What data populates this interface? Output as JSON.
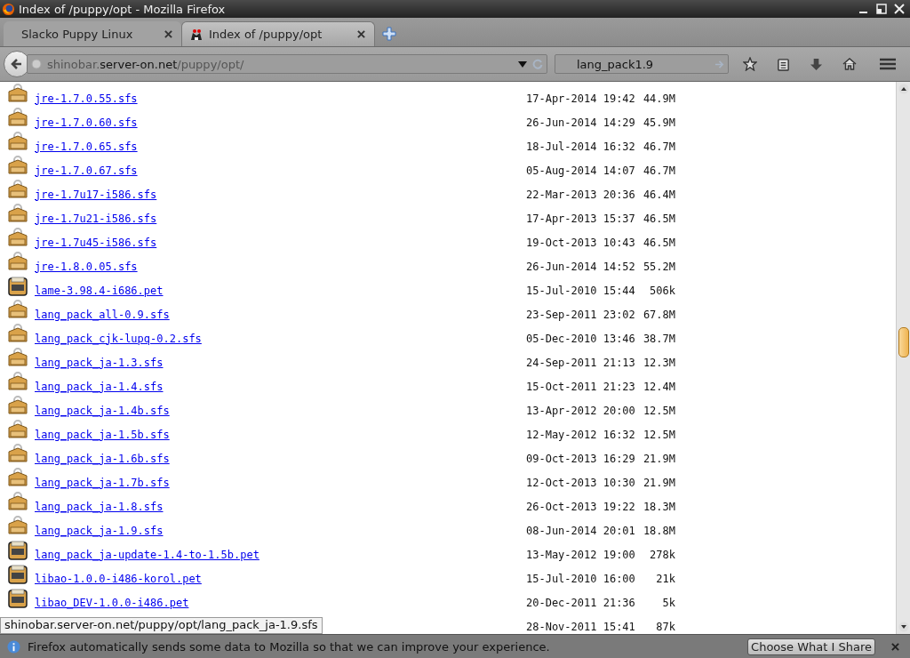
{
  "window": {
    "title": "Index of /puppy/opt - Mozilla Firefox"
  },
  "tabs": [
    {
      "label": "Slacko Puppy Linux",
      "selected": false
    },
    {
      "label": "Index of /puppy/opt",
      "selected": true
    }
  ],
  "address_bar": {
    "host_prefix": "shinobar.",
    "host": "server-on.net",
    "path": "/puppy/opt/"
  },
  "search": {
    "value": "lang_pack1.9"
  },
  "listing": [
    {
      "kind": "sfs",
      "name": "jre-1.7.0.55.sfs",
      "date": "17-Apr-2014 19:42",
      "size": "44.9M"
    },
    {
      "kind": "sfs",
      "name": "jre-1.7.0.60.sfs",
      "date": "26-Jun-2014 14:29",
      "size": "45.9M"
    },
    {
      "kind": "sfs",
      "name": "jre-1.7.0.65.sfs",
      "date": "18-Jul-2014 16:32",
      "size": "46.7M"
    },
    {
      "kind": "sfs",
      "name": "jre-1.7.0.67.sfs",
      "date": "05-Aug-2014 14:07",
      "size": "46.7M"
    },
    {
      "kind": "sfs",
      "name": "jre-1.7u17-i586.sfs",
      "date": "22-Mar-2013 20:36",
      "size": "46.4M"
    },
    {
      "kind": "sfs",
      "name": "jre-1.7u21-i586.sfs",
      "date": "17-Apr-2013 15:37",
      "size": "46.5M"
    },
    {
      "kind": "sfs",
      "name": "jre-1.7u45-i586.sfs",
      "date": "19-Oct-2013 10:43",
      "size": "46.5M"
    },
    {
      "kind": "sfs",
      "name": "jre-1.8.0.05.sfs",
      "date": "26-Jun-2014 14:52",
      "size": "55.2M"
    },
    {
      "kind": "pet",
      "name": "lame-3.98.4-i686.pet",
      "date": "15-Jul-2010 15:44",
      "size": "506k"
    },
    {
      "kind": "sfs",
      "name": "lang_pack_all-0.9.sfs",
      "date": "23-Sep-2011 23:02",
      "size": "67.8M"
    },
    {
      "kind": "sfs",
      "name": "lang_pack_cjk-lupq-0.2.sfs",
      "date": "05-Dec-2010 13:46",
      "size": "38.7M"
    },
    {
      "kind": "sfs",
      "name": "lang_pack_ja-1.3.sfs",
      "date": "24-Sep-2011 21:13",
      "size": "12.3M"
    },
    {
      "kind": "sfs",
      "name": "lang_pack_ja-1.4.sfs",
      "date": "15-Oct-2011 21:23",
      "size": "12.4M"
    },
    {
      "kind": "sfs",
      "name": "lang_pack_ja-1.4b.sfs",
      "date": "13-Apr-2012 20:00",
      "size": "12.5M"
    },
    {
      "kind": "sfs",
      "name": "lang_pack_ja-1.5b.sfs",
      "date": "12-May-2012 16:32",
      "size": "12.5M"
    },
    {
      "kind": "sfs",
      "name": "lang_pack_ja-1.6b.sfs",
      "date": "09-Oct-2013 16:29",
      "size": "21.9M"
    },
    {
      "kind": "sfs",
      "name": "lang_pack_ja-1.7b.sfs",
      "date": "12-Oct-2013 10:30",
      "size": "21.9M"
    },
    {
      "kind": "sfs",
      "name": "lang_pack_ja-1.8.sfs",
      "date": "26-Oct-2013 19:22",
      "size": "18.3M"
    },
    {
      "kind": "sfs",
      "name": "lang_pack_ja-1.9.sfs",
      "date": "08-Jun-2014 20:01",
      "size": "18.8M"
    },
    {
      "kind": "pet",
      "name": "lang_pack_ja-update-1.4-to-1.5b.pet",
      "date": "13-May-2012 19:00",
      "size": "278k"
    },
    {
      "kind": "pet",
      "name": "libao-1.0.0-i486-korol.pet",
      "date": "15-Jul-2010 16:00",
      "size": "21k"
    },
    {
      "kind": "pet",
      "name": "libao_DEV-1.0.0-i486.pet",
      "date": "20-Dec-2011 21:36",
      "size": "5k"
    },
    {
      "date": "28-Nov-2011 15:41",
      "size": "87k"
    }
  ],
  "link_status": "shinobar.server-on.net/puppy/opt/lang_pack_ja-1.9.sfs",
  "notification": {
    "message": "Firefox automatically sends some data to Mozilla so that we can improve your experience.",
    "button": "Choose What I Share"
  }
}
